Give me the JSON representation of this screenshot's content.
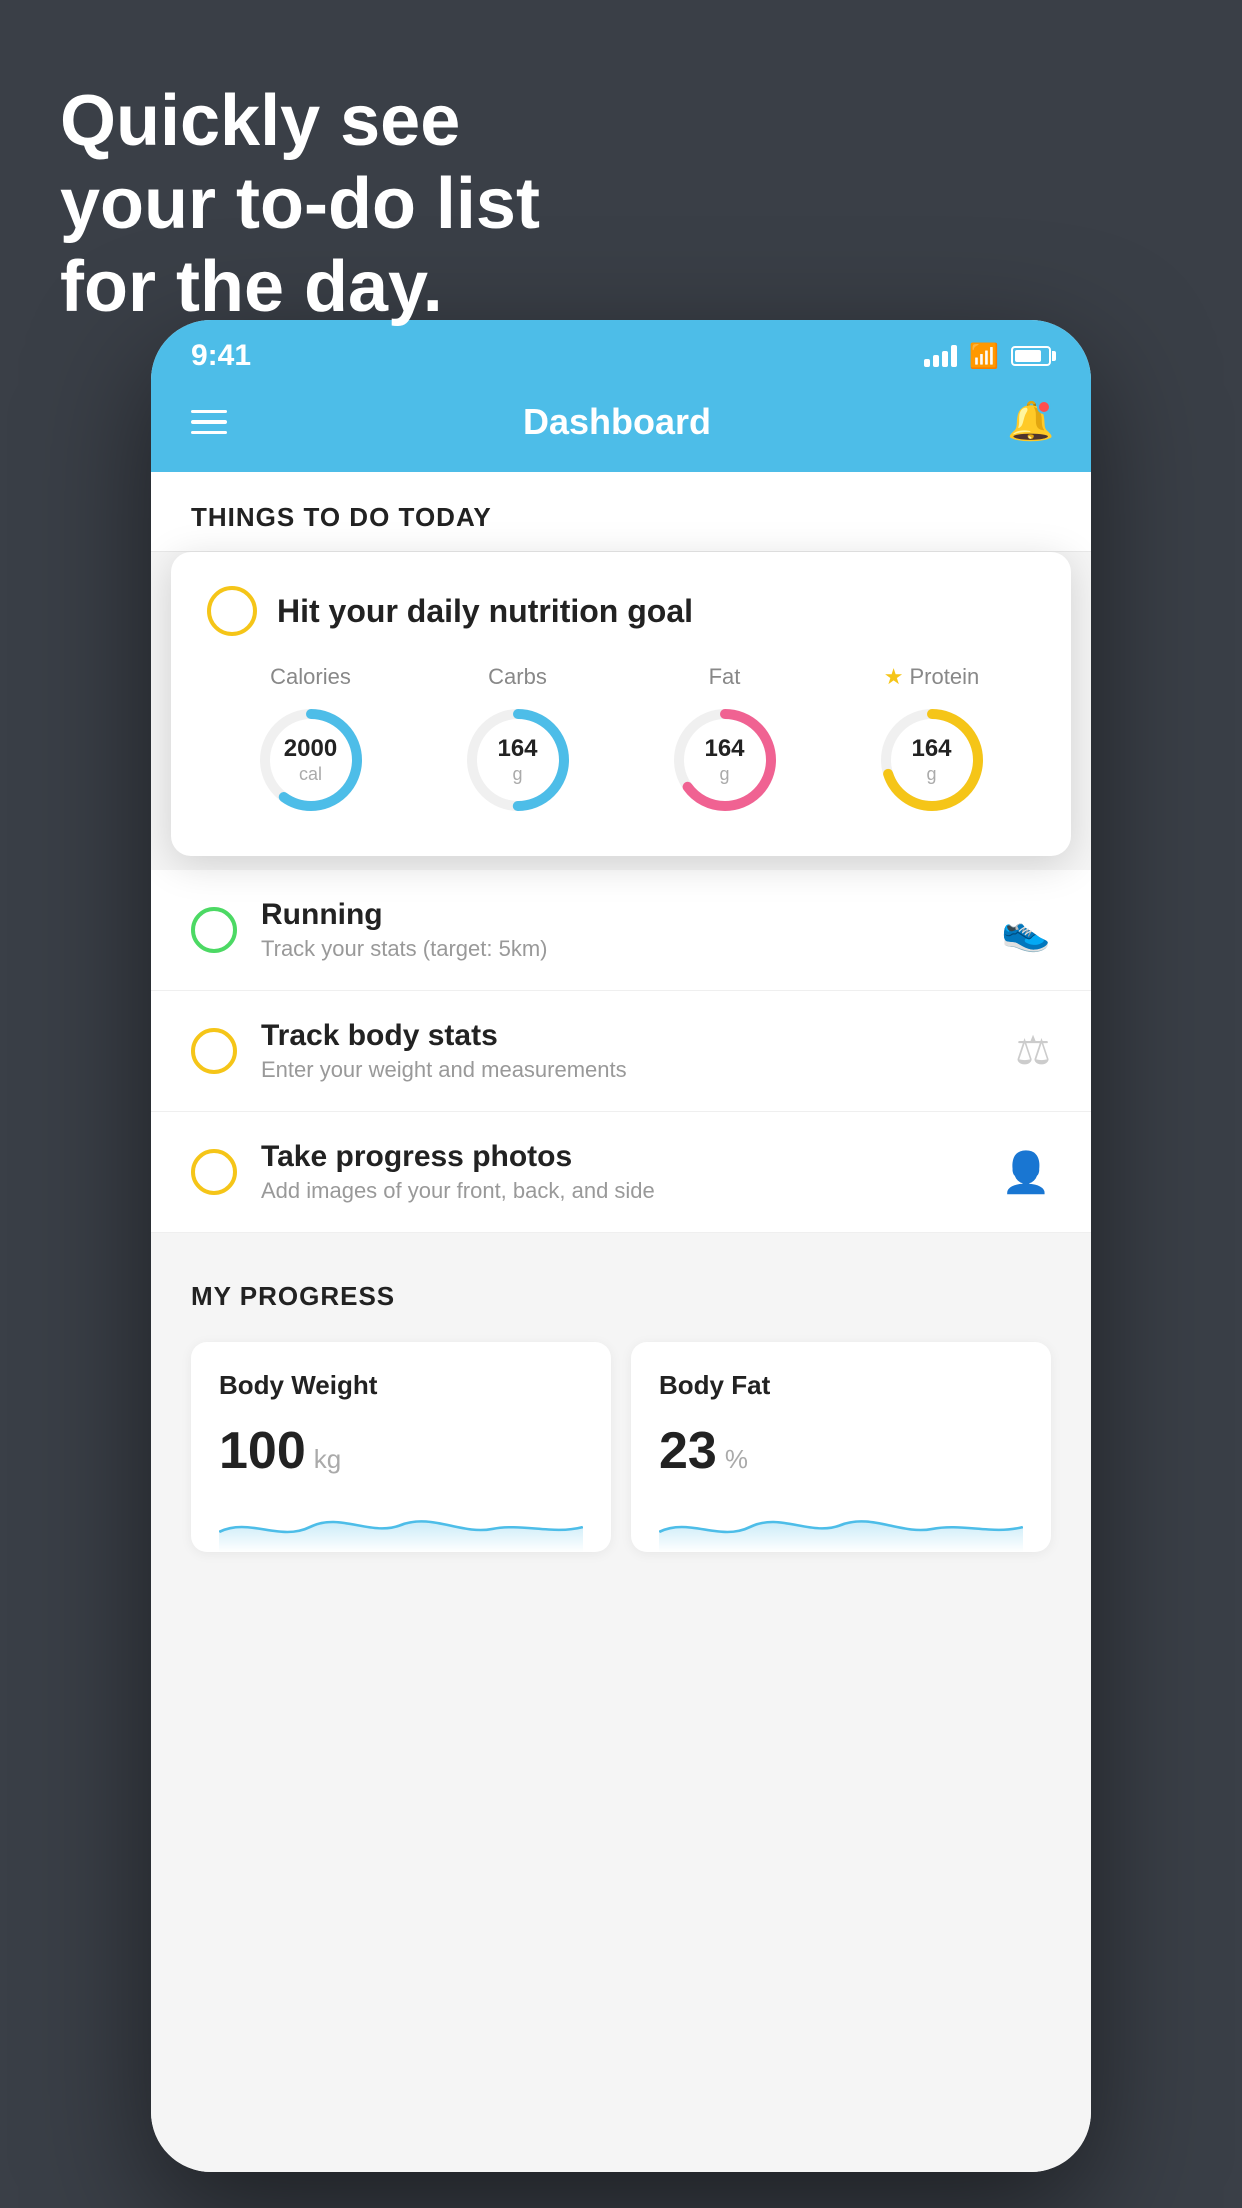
{
  "hero": {
    "line1": "Quickly see",
    "line2": "your to-do list",
    "line3": "for the day."
  },
  "statusBar": {
    "time": "9:41"
  },
  "header": {
    "title": "Dashboard"
  },
  "todoSection": {
    "heading": "THINGS TO DO TODAY"
  },
  "nutritionCard": {
    "title": "Hit your daily nutrition goal",
    "items": [
      {
        "label": "Calories",
        "value": "2000",
        "unit": "cal",
        "color": "#4dbde8",
        "percent": 60
      },
      {
        "label": "Carbs",
        "value": "164",
        "unit": "g",
        "color": "#4dbde8",
        "percent": 50
      },
      {
        "label": "Fat",
        "value": "164",
        "unit": "g",
        "color": "#f06292",
        "percent": 65
      },
      {
        "label": "Protein",
        "value": "164",
        "unit": "g",
        "color": "#f5c518",
        "percent": 70,
        "star": true
      }
    ]
  },
  "todoItems": [
    {
      "title": "Running",
      "subtitle": "Track your stats (target: 5km)",
      "circleColor": "green",
      "icon": "👟"
    },
    {
      "title": "Track body stats",
      "subtitle": "Enter your weight and measurements",
      "circleColor": "yellow",
      "icon": "⚖"
    },
    {
      "title": "Take progress photos",
      "subtitle": "Add images of your front, back, and side",
      "circleColor": "yellow",
      "icon": "👤"
    }
  ],
  "progressSection": {
    "heading": "MY PROGRESS",
    "cards": [
      {
        "title": "Body Weight",
        "value": "100",
        "unit": "kg"
      },
      {
        "title": "Body Fat",
        "value": "23",
        "unit": "%"
      }
    ]
  }
}
